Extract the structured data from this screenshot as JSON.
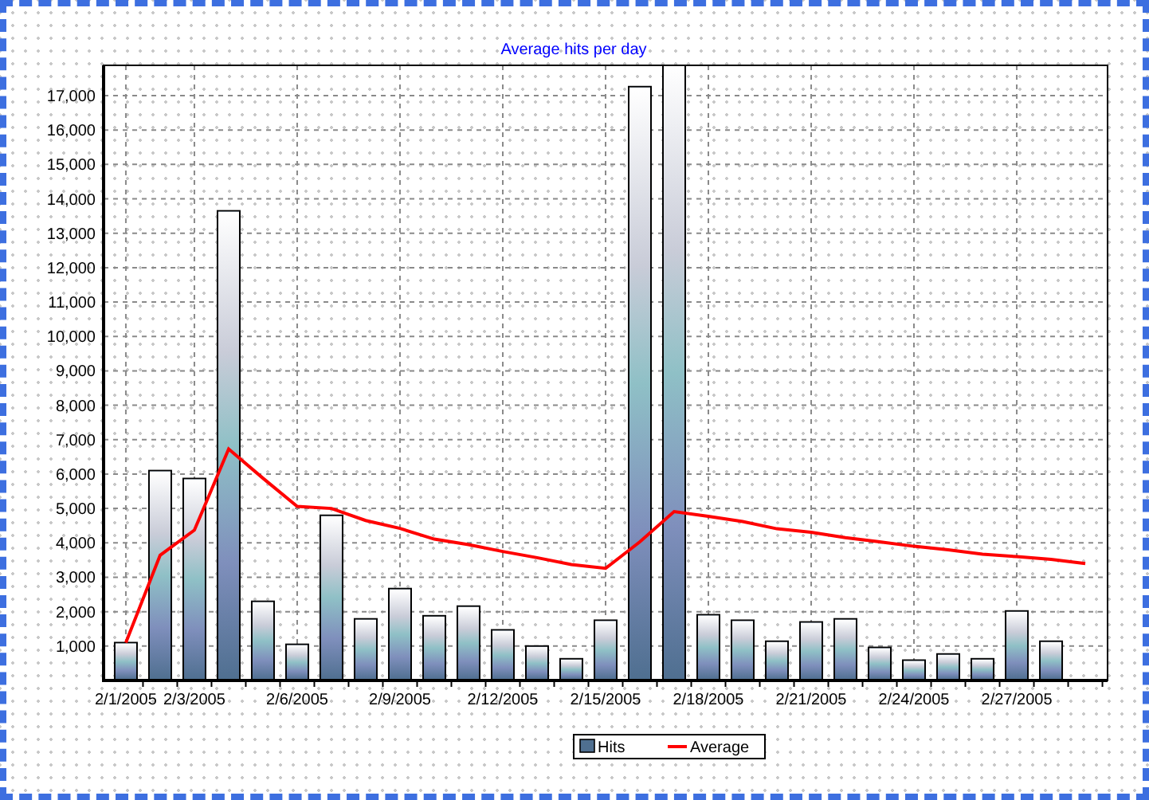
{
  "chart_data": {
    "type": "bar",
    "title": "Average hits per day",
    "grid": true,
    "legend": "bottom",
    "categories": [
      "2/1/2005",
      null,
      "2/3/2005",
      null,
      null,
      "2/6/2005",
      null,
      null,
      "2/9/2005",
      null,
      null,
      "2/12/2005",
      null,
      null,
      "2/15/2005",
      null,
      null,
      "2/18/2005",
      null,
      null,
      "2/21/2005",
      null,
      null,
      "2/24/2005",
      null,
      null,
      "2/27/2005",
      null,
      null
    ],
    "series": [
      {
        "name": "Hits",
        "type": "bar",
        "color": "#4f6f90",
        "values": [
          1100,
          6100,
          5870,
          13650,
          2300,
          1050,
          4800,
          1790,
          2670,
          1880,
          2160,
          1470,
          1000,
          630,
          1750,
          17260,
          17880,
          1910,
          1750,
          1140,
          1700,
          1790,
          960,
          590,
          770,
          630,
          2020,
          1140,
          null
        ]
      },
      {
        "name": "Average",
        "type": "line",
        "color": "#ff0000",
        "values": [
          1100,
          3640,
          4370,
          6730,
          5880,
          5060,
          5000,
          4650,
          4420,
          4110,
          3950,
          3750,
          3570,
          3370,
          3260,
          4030,
          4910,
          4770,
          4620,
          4410,
          4310,
          4150,
          4030,
          3900,
          3800,
          3670,
          3600,
          3520,
          3400
        ]
      }
    ],
    "ylim": [
      0,
      17880
    ],
    "yticks": [
      {
        "value": 1000,
        "label": "1,000"
      },
      {
        "value": 2000,
        "label": "2,000"
      },
      {
        "value": 3000,
        "label": "3,000"
      },
      {
        "value": 4000,
        "label": "4,000"
      },
      {
        "value": 5000,
        "label": "5,000"
      },
      {
        "value": 6000,
        "label": "6,000"
      },
      {
        "value": 7000,
        "label": "7,000"
      },
      {
        "value": 8000,
        "label": "8,000"
      },
      {
        "value": 9000,
        "label": "9,000"
      },
      {
        "value": 10000,
        "label": "10,000"
      },
      {
        "value": 11000,
        "label": "11,000"
      },
      {
        "value": 12000,
        "label": "12,000"
      },
      {
        "value": 13000,
        "label": "13,000"
      },
      {
        "value": 14000,
        "label": "14,000"
      },
      {
        "value": 15000,
        "label": "15,000"
      },
      {
        "value": 16000,
        "label": "16,000"
      },
      {
        "value": 17000,
        "label": "17,000"
      }
    ]
  }
}
